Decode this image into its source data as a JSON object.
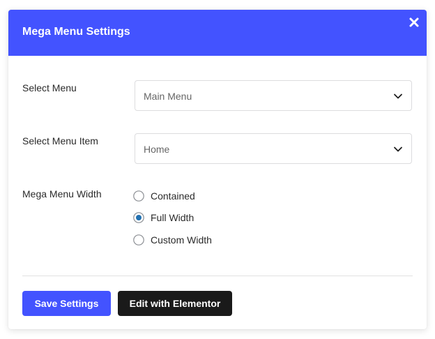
{
  "modal": {
    "title": "Mega Menu Settings",
    "close_icon": "close-icon"
  },
  "fields": {
    "select_menu": {
      "label": "Select Menu",
      "value": "Main Menu",
      "icon": "chevron-down-icon"
    },
    "select_menu_item": {
      "label": "Select Menu Item",
      "value": "Home",
      "icon": "chevron-down-icon"
    },
    "width": {
      "label": "Mega Menu Width",
      "options": [
        {
          "label": "Contained",
          "selected": false
        },
        {
          "label": "Full Width",
          "selected": true
        },
        {
          "label": "Custom Width",
          "selected": false
        }
      ]
    }
  },
  "buttons": {
    "save_label": "Save Settings",
    "elementor_label": "Edit with Elementor"
  },
  "colors": {
    "primary": "#4353ff",
    "dark_button": "#1a1a1a",
    "radio_selected": "#2271b1"
  }
}
